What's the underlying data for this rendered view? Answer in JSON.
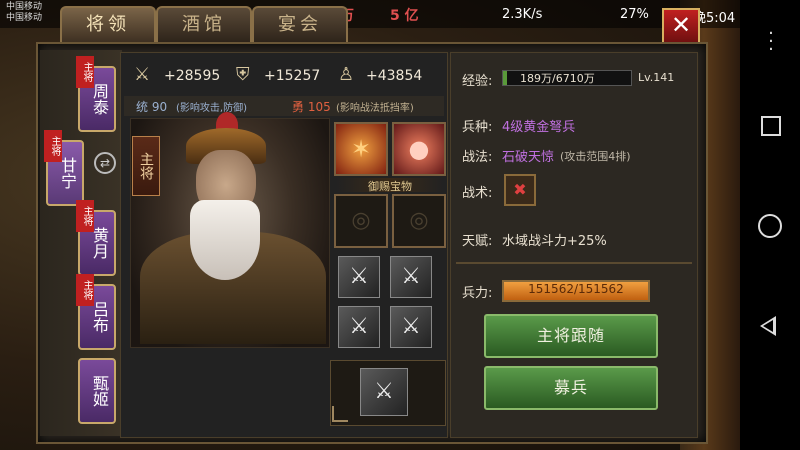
{
  "status": {
    "carrier_1": "中国移动",
    "carrier_2": "中国移动",
    "network_speed": "2.3K/s",
    "battery": "27%",
    "time": "傍晚5:04"
  },
  "resources": {
    "silver": "万",
    "grain_units": "5 亿",
    "other": "3"
  },
  "tabs": [
    "将领",
    "酒馆",
    "宴会"
  ],
  "side_heroes": [
    {
      "name": "周泰",
      "tag": "主将"
    },
    {
      "name": "甘宁",
      "tag": "主将"
    },
    {
      "name": "黄月",
      "tag": "主将"
    },
    {
      "name": "吕布",
      "tag": "主将"
    },
    {
      "name": "甄姬",
      "tag": ""
    }
  ],
  "stats": {
    "attack": "+28595",
    "defense": "+15257",
    "hp": "+43854",
    "tong_label": "统 90",
    "tong_note": "(影响攻击,防御)",
    "yong_label": "勇 105",
    "yong_note": "(影响战法抵挡率)"
  },
  "main_general_label": "主将",
  "treasure_label": "御赐宝物",
  "info": {
    "exp_label": "经验:",
    "exp_value": "189万/6710万",
    "exp_fraction": 0.028,
    "level": "Lv.141",
    "troop_label": "兵种:",
    "troop_value": "4级黄金弩兵",
    "tactic_label": "战法:",
    "tactic_value": "石破天惊",
    "tactic_note": "(攻击范围4排)",
    "skill_label": "战术:",
    "talent_label": "天赋:",
    "talent_value": "水域战斗力+25%",
    "force_label": "兵力:",
    "force_value": "151562/151562",
    "force_fraction": 1.0
  },
  "buttons": {
    "follow": "主将跟随",
    "recruit": "募兵"
  },
  "colors": {
    "troop": "#c070e0",
    "tactic": "#c070e0",
    "accent_red": "#e05050"
  }
}
